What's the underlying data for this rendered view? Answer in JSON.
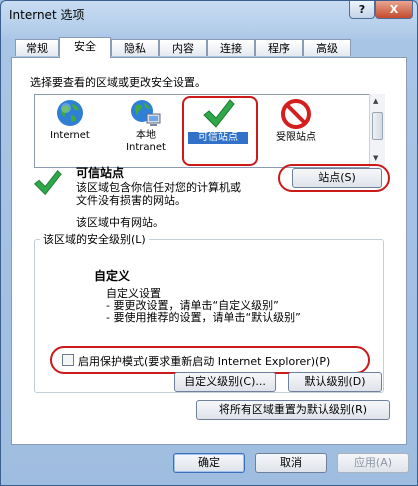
{
  "window": {
    "title": "Internet 选项",
    "help_label": "?",
    "close_label": "X"
  },
  "tabs": [
    {
      "label": "常规",
      "active": false
    },
    {
      "label": "安全",
      "active": true
    },
    {
      "label": "隐私",
      "active": false
    },
    {
      "label": "内容",
      "active": false
    },
    {
      "label": "连接",
      "active": false
    },
    {
      "label": "程序",
      "active": false
    },
    {
      "label": "高级",
      "active": false
    }
  ],
  "security": {
    "zone_prompt": "选择要查看的区域或更改安全设置。",
    "zones": [
      {
        "label": "Internet",
        "label2": "",
        "icon": "globe-icon"
      },
      {
        "label": "本地",
        "label2": "Intranet",
        "icon": "local-intranet-icon"
      },
      {
        "label": "可信站点",
        "label2": "",
        "icon": "checkmark-icon",
        "selected": true
      },
      {
        "label": "受限站点",
        "label2": "",
        "icon": "restricted-icon"
      }
    ],
    "selected_zone": {
      "name": "可信站点",
      "desc_line1": "该区域包含你信任对您的计算机或",
      "desc_line2": "文件没有损害的网站。",
      "sites_note": "该区域中有网站。",
      "sites_button": "站点(S)"
    },
    "level_group": {
      "title": "该区域的安全级别(L)",
      "level_name": "自定义",
      "line1": "自定义设置",
      "line2": "- 要更改设置，请单击“自定义级别”",
      "line3": "- 要使用推荐的设置，请单击“默认级别”"
    },
    "protected_mode": {
      "label": "启用保护模式(要求重新启动 Internet Explorer)(P)",
      "checked": false
    },
    "custom_level_button": "自定义级别(C)...",
    "default_level_button": "默认级别(D)",
    "reset_all_button": "将所有区域重置为默认级别(R)"
  },
  "footer": {
    "ok": "确定",
    "cancel": "取消",
    "apply": "应用(A)"
  },
  "colors": {
    "accent": "#3271c9",
    "highlight_ring": "#cc1a1a",
    "check_green": "#2fa84a"
  }
}
